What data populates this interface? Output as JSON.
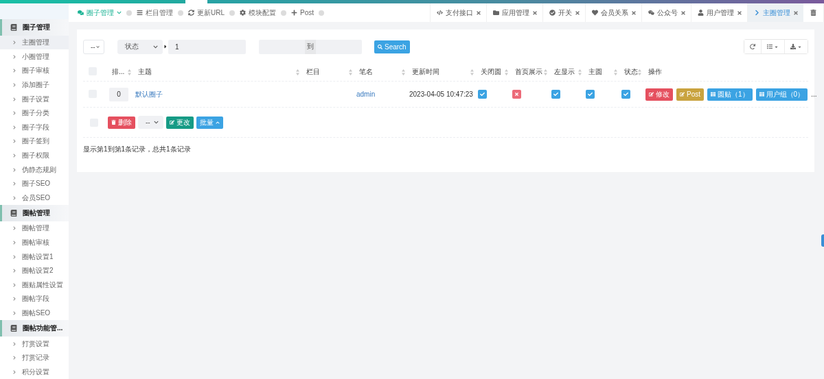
{
  "top_nav": {
    "left": [
      {
        "label": "圈子管理",
        "selected": true
      },
      {
        "label": "栏目管理",
        "selected": false
      },
      {
        "label": "更新URL",
        "selected": false
      },
      {
        "label": "模块配置",
        "selected": false
      },
      {
        "label": "Post",
        "selected": false
      }
    ],
    "tabs": [
      {
        "label": "支付接口",
        "selected": false
      },
      {
        "label": "应用管理",
        "selected": false
      },
      {
        "label": "开关",
        "selected": false
      },
      {
        "label": "会员关系",
        "selected": false
      },
      {
        "label": "公众号",
        "selected": false
      },
      {
        "label": "用户管理",
        "selected": false
      },
      {
        "label": "主圈管理",
        "selected": true
      }
    ]
  },
  "sidebar": [
    {
      "title": "圈子管理",
      "items": [
        {
          "label": "主圈管理",
          "selected": true
        },
        {
          "label": "小圈管理",
          "selected": false
        },
        {
          "label": "圈子审核",
          "selected": false
        },
        {
          "label": "添加圈子",
          "selected": false
        },
        {
          "label": "圈子设置",
          "selected": false
        },
        {
          "label": "圈子分类",
          "selected": false
        },
        {
          "label": "圈子字段",
          "selected": false
        },
        {
          "label": "圈子签到",
          "selected": false
        },
        {
          "label": "圈子权限",
          "selected": false
        },
        {
          "label": "伪静态规则",
          "selected": false
        },
        {
          "label": "圈子SEO",
          "selected": false
        },
        {
          "label": "会员SEO",
          "selected": false
        }
      ]
    },
    {
      "title": "圈帖管理",
      "items": [
        {
          "label": "圈帖管理",
          "selected": false
        },
        {
          "label": "圈帖审核",
          "selected": false
        },
        {
          "label": "圈帖设置1",
          "selected": false
        },
        {
          "label": "圈帖设置2",
          "selected": false
        },
        {
          "label": "圈贴属性设置",
          "selected": false
        },
        {
          "label": "圈帖字段",
          "selected": false
        },
        {
          "label": "圈帖SEO",
          "selected": false
        }
      ]
    },
    {
      "title": "圈帖功能管...",
      "items": [
        {
          "label": "打赏设置",
          "selected": false
        },
        {
          "label": "打赏记录",
          "selected": false
        },
        {
          "label": "积分设置",
          "selected": false
        }
      ]
    }
  ],
  "toolbar": {
    "filter": "--",
    "field": "状态",
    "value": "1",
    "range_addon": "到",
    "search": "Search"
  },
  "table": {
    "select_all": {
      "checked": false
    },
    "columns": [
      {
        "label": "排...",
        "sortable": true
      },
      {
        "label": "主题",
        "sortable": true
      },
      {
        "label": "栏目",
        "sortable": true
      },
      {
        "label": "笔名",
        "sortable": true
      },
      {
        "label": "更新时间",
        "sortable": true
      },
      {
        "label": "关闭圆",
        "sortable": true
      },
      {
        "label": "首页展示",
        "sortable": true
      },
      {
        "label": "左显示",
        "sortable": true
      },
      {
        "label": "主圆",
        "sortable": true
      },
      {
        "label": "状态",
        "sortable": true
      },
      {
        "label": "操作",
        "sortable": false
      }
    ],
    "rows": [
      {
        "checked": false,
        "order": "0",
        "title": "默认圈子",
        "author": "admin",
        "updated": "2023-04-05 10:47:23",
        "flags": [
          {
            "on": true
          },
          {
            "on": false
          },
          {
            "on": true
          },
          {
            "on": true
          },
          {
            "on": true
          }
        ],
        "actions": [
          {
            "label": "修改",
            "color": "#e5505f"
          },
          {
            "label": "Post",
            "color": "#c9a33f"
          },
          {
            "label": "圆贴（1）",
            "color": "#3ba3e3"
          },
          {
            "label": "用户组（0）",
            "color": "#3ba3e3"
          }
        ],
        "more": "..."
      }
    ]
  },
  "batch": {
    "checked": false,
    "delete": "删除",
    "select": "--",
    "change": "更改",
    "bulk": "批量"
  },
  "summary": "显示第1到第1条记录，总共1条记录"
}
